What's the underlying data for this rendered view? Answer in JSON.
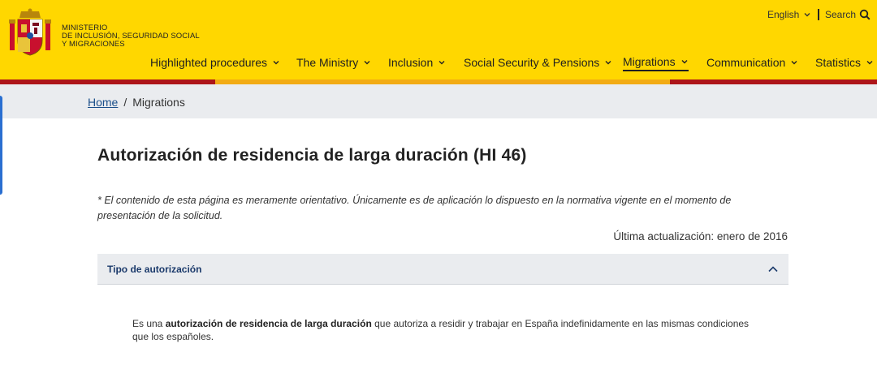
{
  "header": {
    "ministry_lines": [
      "MINISTERIO",
      "DE INCLUSIÓN, SEGURIDAD SOCIAL",
      "Y MIGRACIONES"
    ],
    "language": "English",
    "search": "Search",
    "nav": [
      {
        "label": "Highlighted procedures"
      },
      {
        "label": "The Ministry"
      },
      {
        "label": "Inclusion"
      },
      {
        "label": "Social Security & Pensions"
      },
      {
        "label": "Migrations"
      },
      {
        "label": "Communication"
      },
      {
        "label": "Statistics"
      }
    ],
    "active_nav": "Migrations",
    "colors": {
      "yellow": "#ffd700",
      "red": "#ad1519",
      "orange": "#f2ab14"
    }
  },
  "breadcrumb": {
    "home": "Home",
    "separator": "/",
    "current": "Migrations"
  },
  "main": {
    "title": "Autorización de residencia de larga duración (HI 46)",
    "note": "* El contenido de esta página es meramente orientativo. Únicamente es de aplicación lo dispuesto en la normativa vigente en el momento de presentación de la solicitud.",
    "updated": "Última actualización: enero de 2016",
    "accordion": {
      "title": "Tipo de autorización",
      "body_prefix": "Es una ",
      "body_bold": "autorización de residencia de larga duración",
      "body_suffix": " que autoriza a residir y trabajar en España indefinidamente en las mismas condiciones que los españoles."
    }
  }
}
